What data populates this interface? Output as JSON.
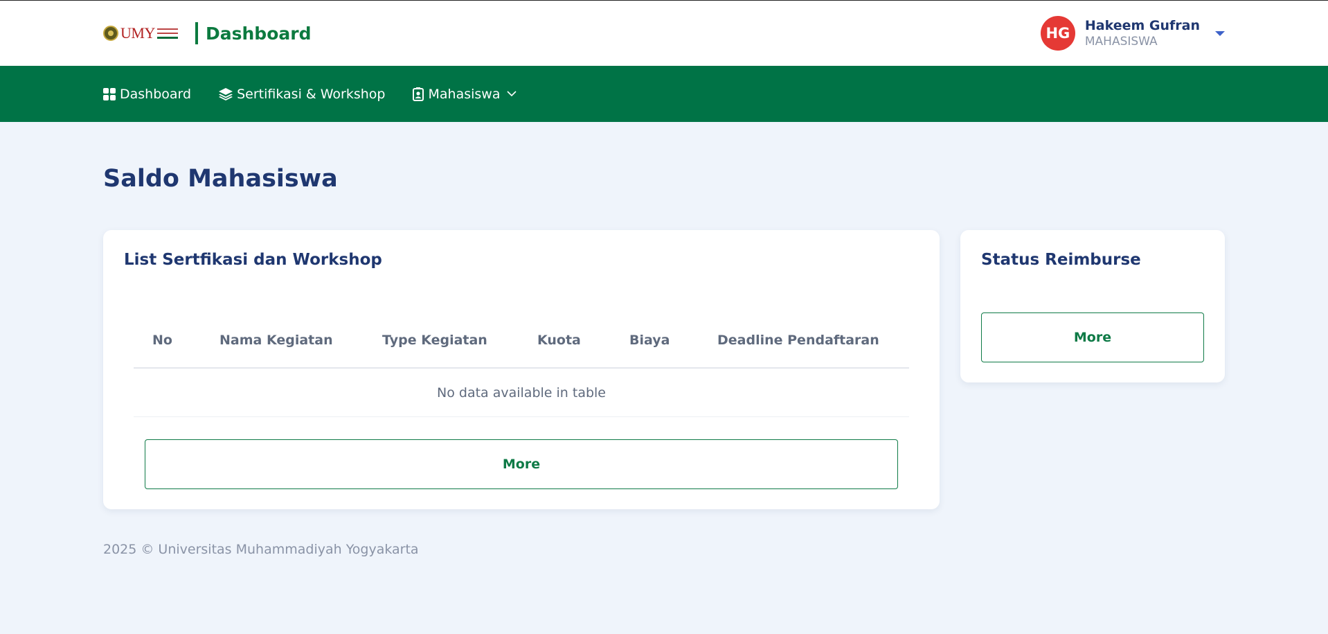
{
  "header": {
    "logo_text": "UMY",
    "title": "Dashboard",
    "user": {
      "initials": "HG",
      "name": "Hakeem Gufran",
      "role": "MAHASISWA"
    }
  },
  "nav": {
    "items": [
      {
        "label": "Dashboard",
        "icon": "grid-icon"
      },
      {
        "label": "Sertifikasi & Workshop",
        "icon": "layers-icon"
      },
      {
        "label": "Mahasiswa",
        "icon": "id-badge-icon",
        "dropdown": true
      }
    ]
  },
  "main": {
    "page_title": "Saldo Mahasiswa",
    "list_card": {
      "title": "List Sertfikasi dan Workshop",
      "columns": [
        "No",
        "Nama Kegiatan",
        "Type Kegiatan",
        "Kuota",
        "Biaya",
        "Deadline Pendaftaran"
      ],
      "empty_text": "No data available in table",
      "more_label": "More"
    },
    "status_card": {
      "title": "Status Reimburse",
      "more_label": "More"
    }
  },
  "footer": {
    "text": "2025 © Universitas Muhammadiyah Yogyakarta"
  },
  "colors": {
    "brand_green": "#007346",
    "accent_green": "#0c7a3f",
    "avatar_red": "#e53935",
    "background": "#eff4fb",
    "heading_navy": "#1f3770"
  }
}
